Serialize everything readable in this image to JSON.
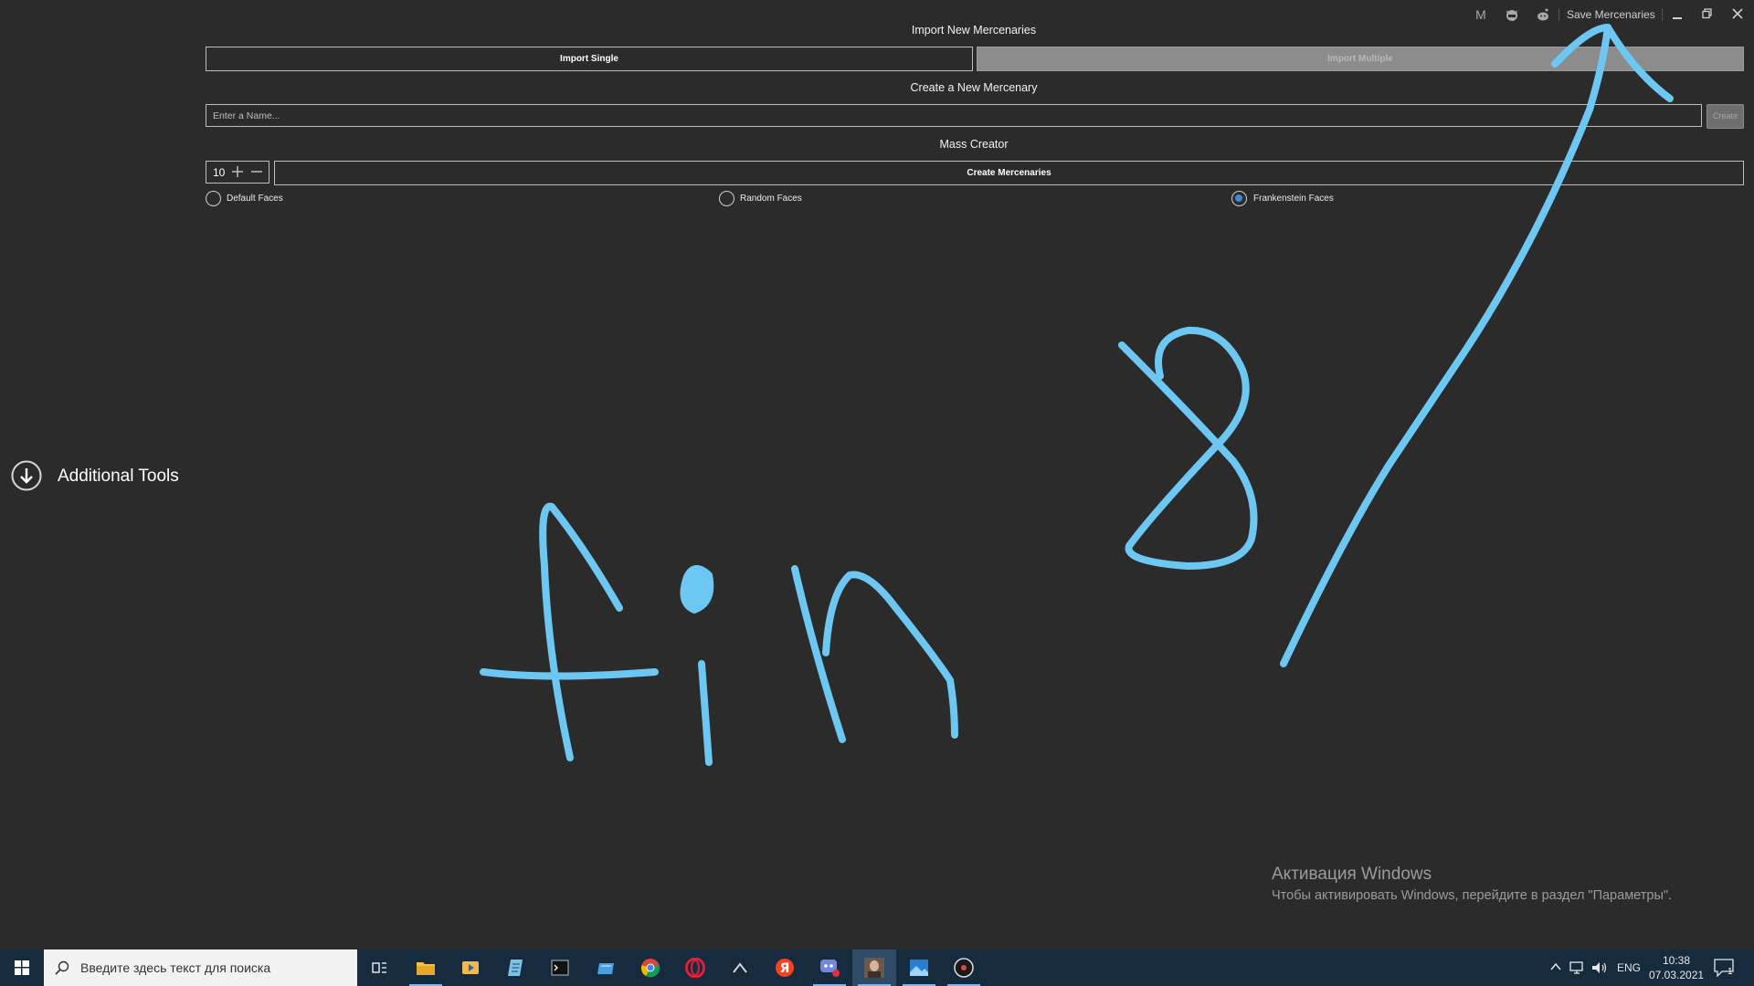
{
  "titlebar": {
    "save_label": "Save Mercenaries",
    "m_label": "M",
    "icons": [
      "github-icon",
      "reddit-icon",
      "minimize-icon",
      "restore-icon",
      "close-icon"
    ]
  },
  "import": {
    "heading": "Import New Mercenaries",
    "single_label": "Import Single",
    "multiple_label": "Import Multiple"
  },
  "create": {
    "heading": "Create a New Mercenary",
    "placeholder": "Enter a Name...",
    "create_label": "Create"
  },
  "mass": {
    "heading": "Mass Creator",
    "count": "10",
    "create_label": "Create Mercenaries",
    "face_options": [
      {
        "label": "Default Faces",
        "checked": false
      },
      {
        "label": "Random Faces",
        "checked": false
      },
      {
        "label": "Frankenstein Faces",
        "checked": true
      }
    ]
  },
  "sidebar": {
    "additional_tools_label": "Additional Tools"
  },
  "annotation": {
    "stroke_color": "#6cc8f2",
    "text": "fin 8/"
  },
  "watermark": {
    "title": "Активация Windows",
    "subtitle": "Чтобы активировать Windows, перейдите в раздел \"Параметры\"."
  },
  "taskbar": {
    "search_placeholder": "Введите здесь текст для поиска",
    "lang": "ENG",
    "time": "10:38",
    "date": "07.03.2021",
    "notification_count": "1",
    "apps": [
      "task-view-icon",
      "file-explorer-icon",
      "media-player-icon",
      "notepad-icon",
      "terminal-icon",
      "folder-icon",
      "chrome-icon",
      "opera-icon",
      "steam-icon",
      "yandex-icon",
      "discord-icon",
      "game-portrait-icon",
      "photos-icon",
      "music-icon"
    ]
  },
  "colors": {
    "background": "#2b2b2b",
    "accent": "#3d8ad6",
    "taskbar": "#172b3f"
  }
}
